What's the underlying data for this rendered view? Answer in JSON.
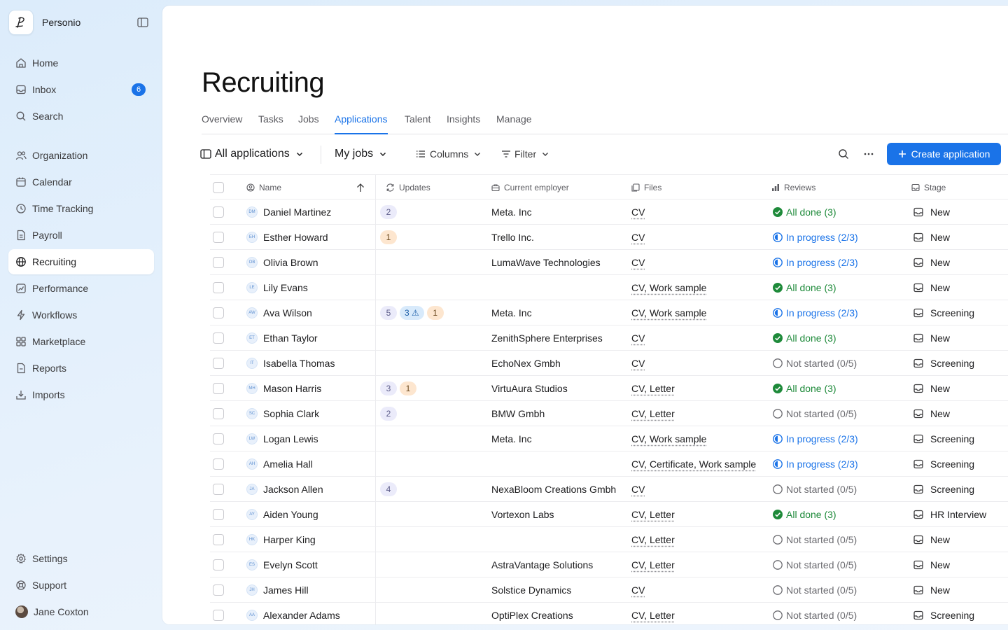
{
  "app": {
    "name": "Personio"
  },
  "nav": {
    "home": "Home",
    "inbox": "Inbox",
    "inbox_badge": "6",
    "search": "Search",
    "organization": "Organization",
    "calendar": "Calendar",
    "time_tracking": "Time Tracking",
    "payroll": "Payroll",
    "recruiting": "Recruiting",
    "performance": "Performance",
    "workflows": "Workflows",
    "marketplace": "Marketplace",
    "reports": "Reports",
    "imports": "Imports",
    "settings": "Settings",
    "support": "Support",
    "user": "Jane Coxton"
  },
  "page": {
    "title": "Recruiting"
  },
  "tabs": [
    "Overview",
    "Tasks",
    "Jobs",
    "Applications",
    "Talent",
    "Insights",
    "Manage"
  ],
  "active_tab": "Applications",
  "toolbar": {
    "view": "All applications",
    "jobs": "My jobs",
    "columns": "Columns",
    "filter": "Filter",
    "create": "Create application"
  },
  "columns": {
    "name": "Name",
    "updates": "Updates",
    "employer": "Current employer",
    "files": "Files",
    "reviews": "Reviews",
    "stage": "Stage"
  },
  "colors": {
    "accent": "#1a73e8",
    "done": "#1e8a3a"
  },
  "rows": [
    {
      "initials": "DM",
      "name": "Daniel Martinez",
      "updates": [
        {
          "t": "2",
          "c": "purple"
        }
      ],
      "employer": "Meta. Inc",
      "files": "CV",
      "review_status": "done",
      "review": "All done (3)",
      "stage": "New"
    },
    {
      "initials": "EH",
      "name": "Esther Howard",
      "updates": [
        {
          "t": "1",
          "c": "orange"
        }
      ],
      "employer": "Trello Inc.",
      "files": "CV",
      "review_status": "prog",
      "review": "In progress (2/3)",
      "stage": "New"
    },
    {
      "initials": "OB",
      "name": "Olivia Brown",
      "updates": [],
      "employer": "LumaWave Technologies",
      "files": "CV",
      "review_status": "prog",
      "review": "In progress (2/3)",
      "stage": "New"
    },
    {
      "initials": "LE",
      "name": "Lily Evans",
      "updates": [],
      "employer": "",
      "files": "CV, Work sample",
      "review_status": "done",
      "review": "All done (3)",
      "stage": "New"
    },
    {
      "initials": "AW",
      "name": "Ava Wilson",
      "updates": [
        {
          "t": "5",
          "c": "purple"
        },
        {
          "t": "3 ⚠",
          "c": "blue"
        },
        {
          "t": "1",
          "c": "orange"
        }
      ],
      "employer": "Meta. Inc",
      "files": "CV, Work sample",
      "review_status": "prog",
      "review": "In progress (2/3)",
      "stage": "Screening"
    },
    {
      "initials": "ET",
      "name": "Ethan Taylor",
      "updates": [],
      "employer": "ZenithSphere Enterprises",
      "files": "CV",
      "review_status": "done",
      "review": "All done (3)",
      "stage": "New"
    },
    {
      "initials": "IT",
      "name": "Isabella Thomas",
      "updates": [],
      "employer": "EchoNex Gmbh",
      "files": "CV",
      "review_status": "not",
      "review": "Not started (0/5)",
      "stage": "Screening"
    },
    {
      "initials": "MH",
      "name": "Mason Harris",
      "updates": [
        {
          "t": "3",
          "c": "purple"
        },
        {
          "t": "1",
          "c": "orange"
        }
      ],
      "employer": "VirtuAura Studios",
      "files": "CV, Letter",
      "review_status": "done",
      "review": "All done (3)",
      "stage": "New"
    },
    {
      "initials": "SC",
      "name": "Sophia Clark",
      "updates": [
        {
          "t": "2",
          "c": "purple"
        }
      ],
      "employer": "BMW Gmbh",
      "files": "CV, Letter",
      "review_status": "not",
      "review": "Not started (0/5)",
      "stage": "New"
    },
    {
      "initials": "LW",
      "name": "Logan Lewis",
      "updates": [],
      "employer": "Meta. Inc",
      "files": "CV, Work sample",
      "review_status": "prog",
      "review": "In progress (2/3)",
      "stage": "Screening"
    },
    {
      "initials": "AH",
      "name": "Amelia Hall",
      "updates": [],
      "employer": "",
      "files": "CV, Certificate, Work sample",
      "review_status": "prog",
      "review": "In progress (2/3)",
      "stage": "Screening"
    },
    {
      "initials": "JA",
      "name": "Jackson Allen",
      "updates": [
        {
          "t": "4",
          "c": "purple"
        }
      ],
      "employer": "NexaBloom Creations Gmbh",
      "files": "CV",
      "review_status": "not",
      "review": "Not started (0/5)",
      "stage": "Screening"
    },
    {
      "initials": "AY",
      "name": "Aiden Young",
      "updates": [],
      "employer": "Vortexon Labs",
      "files": "CV, Letter",
      "review_status": "done",
      "review": "All done (3)",
      "stage": "HR Interview"
    },
    {
      "initials": "HK",
      "name": "Harper King",
      "updates": [],
      "employer": "",
      "files": "CV, Letter",
      "review_status": "not",
      "review": "Not started (0/5)",
      "stage": "New"
    },
    {
      "initials": "ES",
      "name": "Evelyn Scott",
      "updates": [],
      "employer": "AstraVantage Solutions",
      "files": "CV, Letter",
      "review_status": "not",
      "review": "Not started (0/5)",
      "stage": "New"
    },
    {
      "initials": "JH",
      "name": "James Hill",
      "updates": [],
      "employer": "Solstice Dynamics",
      "files": "CV",
      "review_status": "not",
      "review": "Not started (0/5)",
      "stage": "New"
    },
    {
      "initials": "AA",
      "name": "Alexander Adams",
      "updates": [],
      "employer": "OptiPlex Creations",
      "files": "CV, Letter",
      "review_status": "not",
      "review": "Not started (0/5)",
      "stage": "Screening"
    }
  ]
}
